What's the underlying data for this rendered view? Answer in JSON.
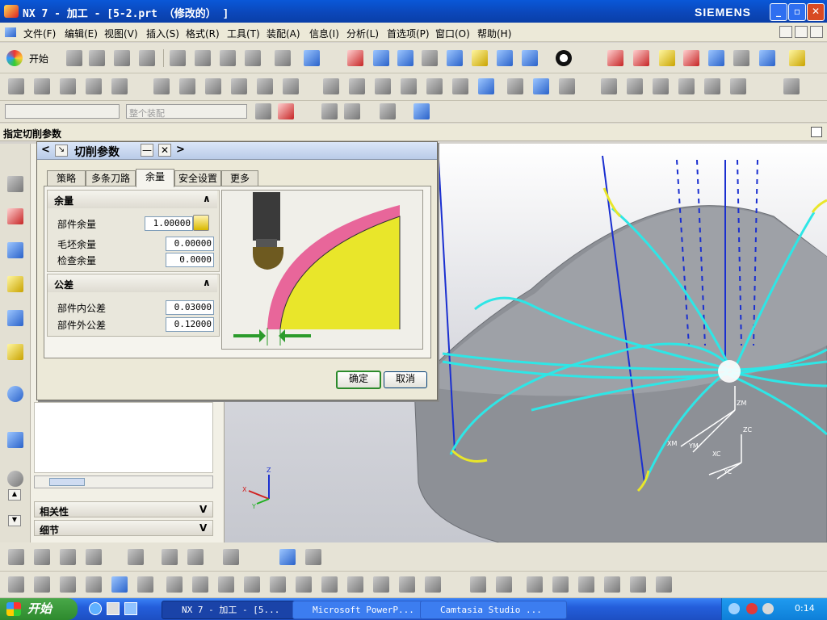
{
  "window": {
    "title": "NX 7 - 加工 - [5-2.prt （修改的） ]",
    "brand": "SIEMENS"
  },
  "menubar": {
    "items": [
      "文件(F)",
      "编辑(E)",
      "视图(V)",
      "插入(S)",
      "格式(R)",
      "工具(T)",
      "装配(A)",
      "信息(I)",
      "分析(L)",
      "首选项(P)",
      "窗口(O)",
      "帮助(H)"
    ]
  },
  "toolbar": {
    "start_label": "开始",
    "assembly_select_placeholder": "整个装配"
  },
  "cue_line": "指定切削参数",
  "dialog": {
    "title": "切削参数",
    "tabs": [
      "策略",
      "多条刀路",
      "余量",
      "安全设置",
      "更多"
    ],
    "active_tab": "余量",
    "stock_group": {
      "header": "余量",
      "rows": [
        {
          "label": "部件余量",
          "value": "1.00000"
        },
        {
          "label": "毛坯余量",
          "value": "0.00000"
        },
        {
          "label": "检查余量",
          "value": "0.0000"
        }
      ]
    },
    "tolerance_group": {
      "header": "公差",
      "rows": [
        {
          "label": "部件内公差",
          "value": "0.03000"
        },
        {
          "label": "部件外公差",
          "value": "0.12000"
        }
      ]
    },
    "ok_label": "确定",
    "cancel_label": "取消"
  },
  "navigator": {
    "sections": [
      "相关性",
      "细节"
    ]
  },
  "viewport": {
    "axis_labels": [
      "ZM",
      "XC",
      "YC",
      "ZC",
      "XM",
      "YM"
    ],
    "triad_labels": [
      "Z",
      "Y",
      "X"
    ]
  },
  "taskbar": {
    "start_label": "开始",
    "tasks": [
      "NX 7 - 加工 - [5...",
      "Microsoft PowerP...",
      "Camtasia Studio ..."
    ],
    "clock": "0:14"
  },
  "colors": {
    "title_bar": "#0b46b8",
    "taskbar": "#245edb",
    "toolpath": "#2ee6e6",
    "stock_pink": "#e8669a",
    "part_yellow": "#e9e62a"
  }
}
